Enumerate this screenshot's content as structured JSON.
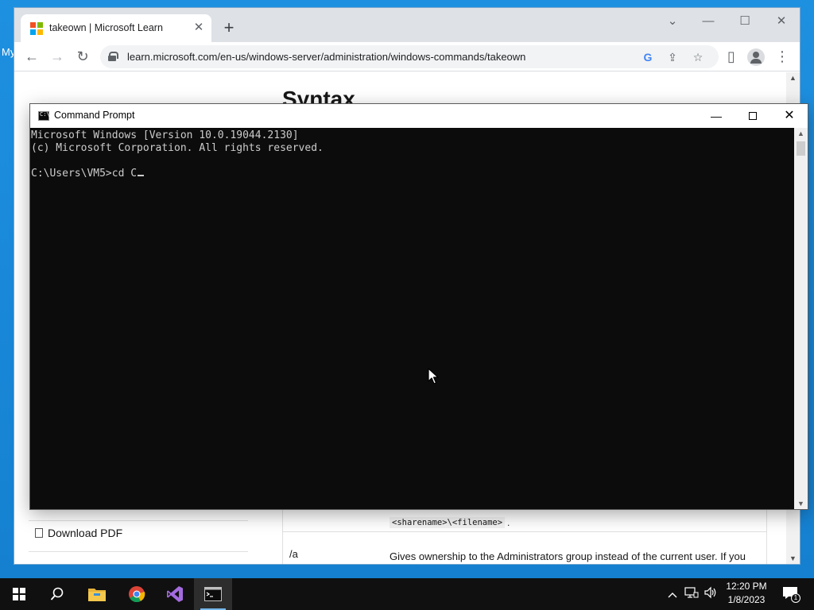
{
  "desktop": {
    "label": "My"
  },
  "browser": {
    "tab_title": "takeown | Microsoft Learn",
    "tab_close": "✕",
    "new_tab": "+",
    "url": "learn.microsoft.com/en-us/windows-server/administration/windows-commands/takeown",
    "window_controls": {
      "dropdown": "⌄",
      "minimize": "—",
      "maximize": "☐",
      "close": "✕"
    },
    "nav": {
      "back": "←",
      "forward": "→",
      "reload": "↻",
      "share": "⇪",
      "bookmark": "☆",
      "sidepanel": "▯",
      "menu": "⋮"
    }
  },
  "page": {
    "heading": "Syntax",
    "download_pdf": "Download PDF",
    "code_snippet": "<sharename>\\<filename>",
    "code_suffix": ".",
    "param_name": "/a",
    "param_description": "Gives ownership to the Administrators group instead of the current user. If you don't specify this option, file ownership is given to the user who is"
  },
  "cmd": {
    "title": "Command Prompt",
    "controls": {
      "minimize": "—",
      "close": "✕"
    },
    "lines": {
      "line1": "Microsoft Windows [Version 10.0.19044.2130]",
      "line2": "(c) Microsoft Corporation. All rights reserved.",
      "line3": "",
      "prompt": "C:\\Users\\VM5>cd C"
    }
  },
  "taskbar": {
    "apps": [
      "start",
      "search",
      "file-explorer",
      "chrome",
      "visual-studio",
      "command-prompt"
    ],
    "active_app": "command-prompt",
    "time": "12:20 PM",
    "date": "1/8/2023",
    "notification_count": "1",
    "tray_icons": [
      "chevron-up",
      "network",
      "volume"
    ]
  },
  "colors": {
    "desktop": "#1a8ad4",
    "console_bg": "#0c0c0c",
    "console_fg": "#cccccc",
    "taskbar": "#101010"
  }
}
